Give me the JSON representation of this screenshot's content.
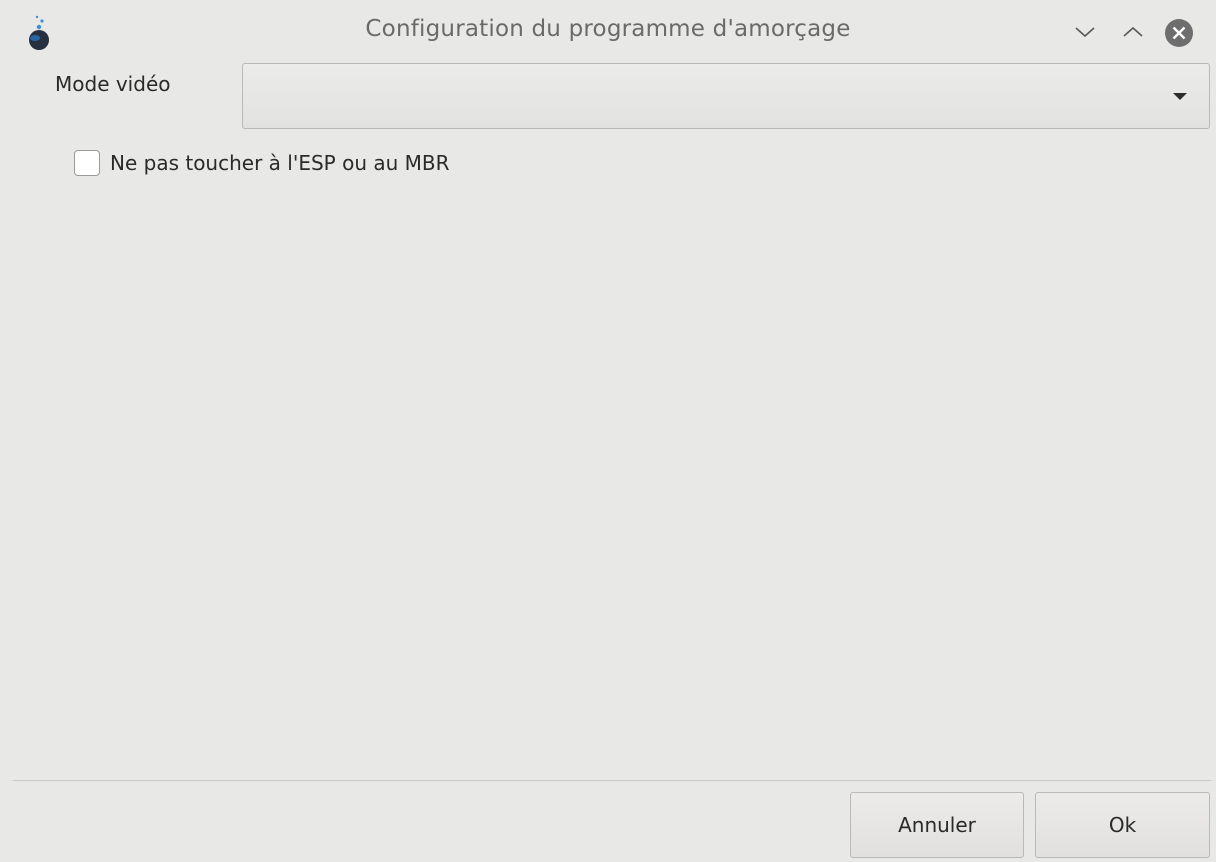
{
  "window": {
    "title": "Configuration du programme d'amorçage"
  },
  "icons": {
    "app": "mageia-app-icon",
    "minimize": "chevron-down-icon",
    "maximize": "chevron-up-icon",
    "close": "close-icon",
    "dropdown": "dropdown-arrow-icon"
  },
  "form": {
    "video_mode_label": "Mode vidéo",
    "video_mode_value": "",
    "esp_mbr_checkbox_label": "Ne pas toucher à l'ESP ou au MBR",
    "esp_mbr_checked": false
  },
  "buttons": {
    "cancel_label": "Annuler",
    "ok_label": "Ok"
  },
  "colors": {
    "background": "#e8e8e7",
    "close_button": "#6e6e6e"
  }
}
